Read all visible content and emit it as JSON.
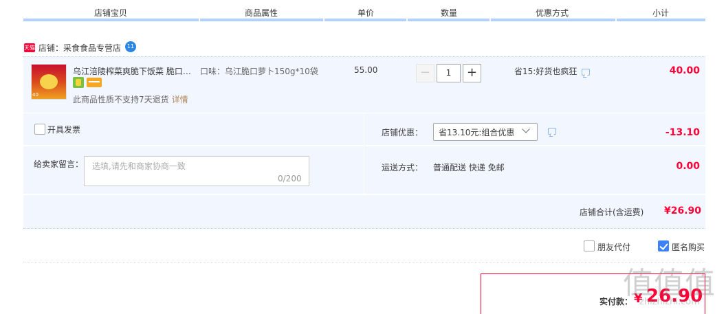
{
  "table_header": {
    "columns": [
      "店铺宝贝",
      "商品属性",
      "单价",
      "数量",
      "优惠方式",
      "小计"
    ]
  },
  "shop": {
    "badge": "天猫",
    "name": "店铺：采食食品专营店",
    "ww_badge": "11"
  },
  "item": {
    "title": "乌江涪陵榨菜爽脆下饭菜 脆口榨菜",
    "thumb_tag": "40",
    "no_return_text": "此商品性质不支持7天退货",
    "detail_link": "详情",
    "attribute": "口味：乌江脆口萝卜150g*10袋",
    "price": "55.00",
    "qty_minus": "−",
    "quantity": "1",
    "qty_plus": "+",
    "promo": "省15:好货也疯狂",
    "subtotal": "40.00"
  },
  "options": {
    "invoice_label": "开具发票",
    "message_label": "给卖家留言：",
    "message_placeholder": "选填,请先和商家协商一致",
    "message_count": "0/200",
    "shop_discount_label": "店铺优惠：",
    "shop_discount_selected": "省13.10元:组合优惠",
    "shop_discount_amount": "-13.10",
    "shipping_label": "运送方式：",
    "shipping_value": "普通配送 快递 免邮",
    "shipping_amount": "0.00"
  },
  "shop_total": {
    "label": "店铺合计(含运费)",
    "amount": "¥26.90"
  },
  "bottom": {
    "friend_pay_label": "朋友代付",
    "friend_pay_checked": false,
    "anonymous_label": "匿名购买",
    "anonymous_checked": true
  },
  "payment": {
    "label": "实付款：",
    "currency": "¥",
    "amount": "26.90"
  },
  "watermark": {
    "text": "值值值",
    "url": "zhizhizhi.com"
  },
  "colors": {
    "accent_red": "#ff0036",
    "header_line": "#b2d1ff",
    "row_bg": "#f2f7ff",
    "check_blue": "#3b82f6"
  }
}
